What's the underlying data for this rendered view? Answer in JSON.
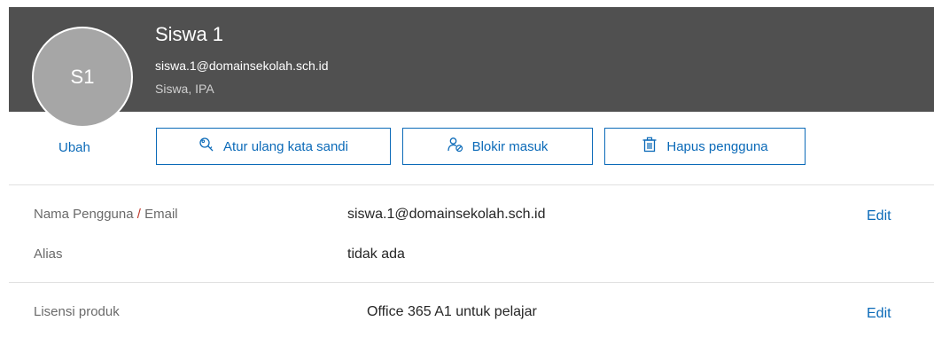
{
  "user": {
    "initials": "S1",
    "name": "Siswa 1",
    "email": "siswa.1@domainsekolah.sch.id",
    "role": "Siswa, IPA"
  },
  "actions": {
    "change_photo": "Ubah",
    "reset_password": "Atur ulang kata sandi",
    "block_signin": "Blokir masuk",
    "delete_user": "Hapus pengguna"
  },
  "details": {
    "username_label_part1": "Nama Pengguna",
    "username_label_sep": "/",
    "username_label_part2": "Email",
    "username_value": "siswa.1@domainsekolah.sch.id",
    "alias_label": "Alias",
    "alias_value": "tidak ada",
    "license_label": "Lisensi produk",
    "license_value": "Office 365 A1 untuk pelajar",
    "edit_label": "Edit"
  },
  "icons": {
    "reset": "key-search-icon",
    "block": "person-block-icon",
    "delete": "trash-icon"
  },
  "colors": {
    "header_bg": "#505050",
    "accent": "#0b6ab8",
    "avatar_bg": "#a6a6a6"
  }
}
